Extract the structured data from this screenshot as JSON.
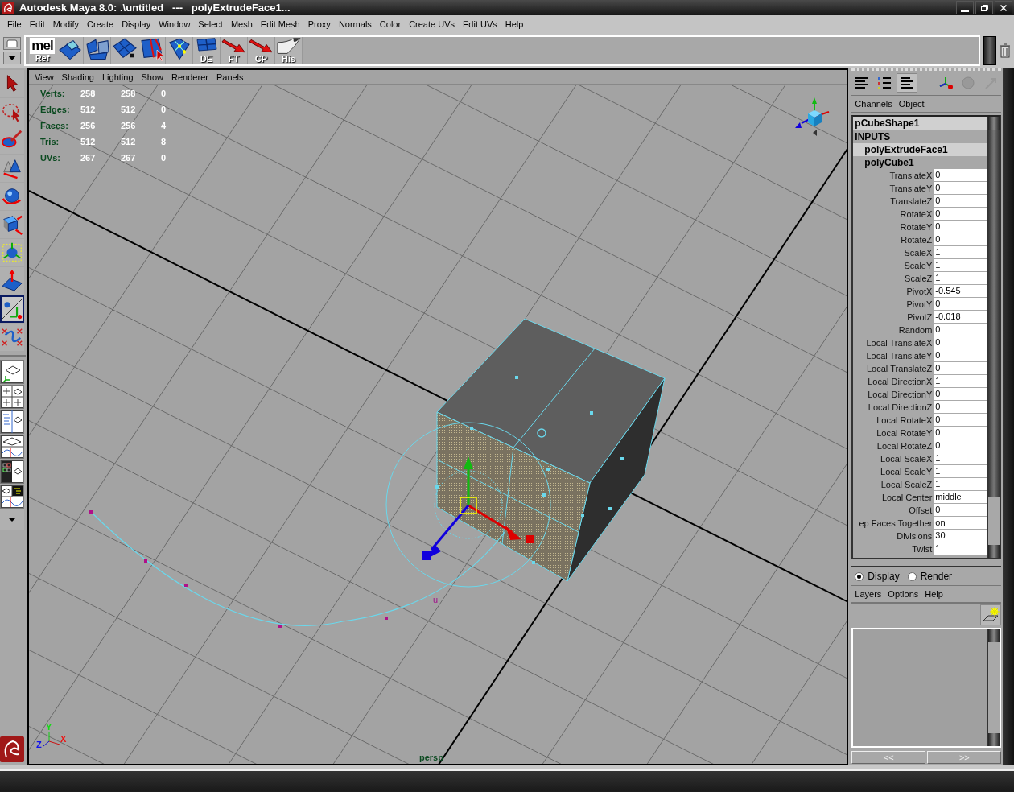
{
  "window": {
    "title": "Autodesk Maya 8.0: .\\untitled   ---   polyExtrudeFace1..."
  },
  "menu_bar": [
    "File",
    "Edit",
    "Modify",
    "Create",
    "Display",
    "Window",
    "Select",
    "Mesh",
    "Edit Mesh",
    "Proxy",
    "Normals",
    "Color",
    "Create UVs",
    "Edit UVs",
    "Help"
  ],
  "shelf": {
    "buttons": [
      {
        "kind": "mel",
        "caption": "mel",
        "label": "Ref"
      },
      {
        "kind": "extrude"
      },
      {
        "kind": "split"
      },
      {
        "kind": "wedge"
      },
      {
        "kind": "cut"
      },
      {
        "kind": "merge"
      },
      {
        "kind": "grid",
        "label": "DE"
      },
      {
        "kind": "arrow",
        "label": "FT"
      },
      {
        "kind": "arrow",
        "label": "CP"
      },
      {
        "kind": "curl",
        "label": "His"
      }
    ]
  },
  "toolbox": {
    "tools": [
      {
        "kind": "select",
        "selected": false
      },
      {
        "kind": "lasso",
        "selected": false
      },
      {
        "kind": "paint",
        "selected": false
      },
      {
        "kind": "move",
        "selected": false
      },
      {
        "kind": "rotate",
        "selected": false
      },
      {
        "kind": "scale",
        "selected": false
      },
      {
        "kind": "universal",
        "selected": false
      },
      {
        "kind": "softmod",
        "selected": false
      },
      {
        "kind": "manip",
        "selected": true
      },
      {
        "kind": "curves",
        "selected": false
      }
    ],
    "layouts": [
      {
        "kind": "single"
      },
      {
        "kind": "four"
      },
      {
        "kind": "outliner"
      },
      {
        "kind": "graph"
      },
      {
        "kind": "hypershade"
      },
      {
        "kind": "graph3"
      }
    ]
  },
  "viewport": {
    "menu": [
      "View",
      "Shading",
      "Lighting",
      "Show",
      "Renderer",
      "Panels"
    ],
    "hud": [
      {
        "label": "Verts:",
        "values": [
          "258",
          "258",
          "0"
        ]
      },
      {
        "label": "Edges:",
        "values": [
          "512",
          "512",
          "0"
        ]
      },
      {
        "label": "Faces:",
        "values": [
          "256",
          "256",
          "4"
        ]
      },
      {
        "label": "Tris:",
        "values": [
          "512",
          "512",
          "8"
        ]
      },
      {
        "label": "UVs:",
        "values": [
          "267",
          "267",
          "0"
        ]
      }
    ],
    "curve_marker": "u",
    "axis_labels": {
      "x": "X",
      "y": "Y",
      "z": "Z"
    },
    "camera": "persp"
  },
  "channel_box": {
    "menu": [
      "Channels",
      "Object"
    ],
    "object": "pCubeShape1",
    "section": "INPUTS",
    "nodes": [
      {
        "name": "polyExtrudeFace1",
        "selected": true
      },
      {
        "name": "polyCube1",
        "selected": false
      }
    ],
    "attributes": [
      {
        "name": "TranslateX",
        "value": "0"
      },
      {
        "name": "TranslateY",
        "value": "0"
      },
      {
        "name": "TranslateZ",
        "value": "0"
      },
      {
        "name": "RotateX",
        "value": "0"
      },
      {
        "name": "RotateY",
        "value": "0"
      },
      {
        "name": "RotateZ",
        "value": "0"
      },
      {
        "name": "ScaleX",
        "value": "1"
      },
      {
        "name": "ScaleY",
        "value": "1"
      },
      {
        "name": "ScaleZ",
        "value": "1"
      },
      {
        "name": "PivotX",
        "value": "-0.545"
      },
      {
        "name": "PivotY",
        "value": "0"
      },
      {
        "name": "PivotZ",
        "value": "-0.018"
      },
      {
        "name": "Random",
        "value": "0"
      },
      {
        "name": "Local TranslateX",
        "value": "0"
      },
      {
        "name": "Local TranslateY",
        "value": "0"
      },
      {
        "name": "Local TranslateZ",
        "value": "0"
      },
      {
        "name": "Local DirectionX",
        "value": "1"
      },
      {
        "name": "Local DirectionY",
        "value": "0"
      },
      {
        "name": "Local DirectionZ",
        "value": "0"
      },
      {
        "name": "Local RotateX",
        "value": "0"
      },
      {
        "name": "Local RotateY",
        "value": "0"
      },
      {
        "name": "Local RotateZ",
        "value": "0"
      },
      {
        "name": "Local ScaleX",
        "value": "1"
      },
      {
        "name": "Local ScaleY",
        "value": "1"
      },
      {
        "name": "Local ScaleZ",
        "value": "1"
      },
      {
        "name": "Local Center",
        "value": "middle"
      },
      {
        "name": "Offset",
        "value": "0"
      },
      {
        "name": "ep Faces Together",
        "value": "on"
      },
      {
        "name": "Divisions",
        "value": "30"
      },
      {
        "name": "Twist",
        "value": "1"
      }
    ]
  },
  "layer_editor": {
    "modes": [
      {
        "label": "Display",
        "selected": true
      },
      {
        "label": "Render",
        "selected": false
      }
    ],
    "menu": [
      "Layers",
      "Options",
      "Help"
    ],
    "nav": [
      "<<",
      ">>"
    ]
  }
}
